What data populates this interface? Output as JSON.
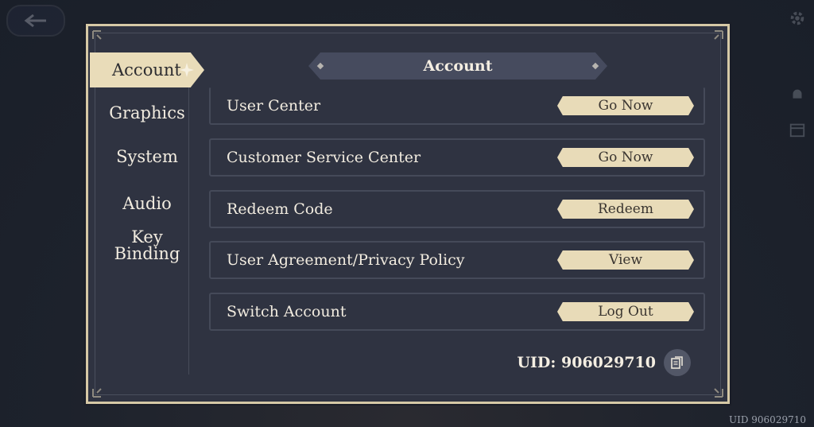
{
  "background": {
    "uid_label": "UID 906029710"
  },
  "sidebar": {
    "items": [
      {
        "label": "Account",
        "active": true
      },
      {
        "label": "Graphics",
        "active": false
      },
      {
        "label": "System",
        "active": false
      },
      {
        "label": "Audio",
        "active": false
      },
      {
        "label": "Key Binding",
        "active": false
      }
    ]
  },
  "panel": {
    "title": "Account",
    "rows": [
      {
        "label": "User Center",
        "button": "Go Now"
      },
      {
        "label": "Customer Service Center",
        "button": "Go Now"
      },
      {
        "label": "Redeem Code",
        "button": "Redeem"
      },
      {
        "label": "User Agreement/Privacy Policy",
        "button": "View"
      },
      {
        "label": "Switch Account",
        "button": "Log Out"
      }
    ],
    "uid": "UID: 906029710"
  },
  "icons": [
    "back-arrow-icon",
    "gear-icon",
    "bell-icon",
    "calendar-icon",
    "copy-icon",
    "sparkle-icon"
  ],
  "colors": {
    "accent": "#e8dbb8",
    "panel": "#2f3341",
    "border": "#d6c9a6"
  }
}
